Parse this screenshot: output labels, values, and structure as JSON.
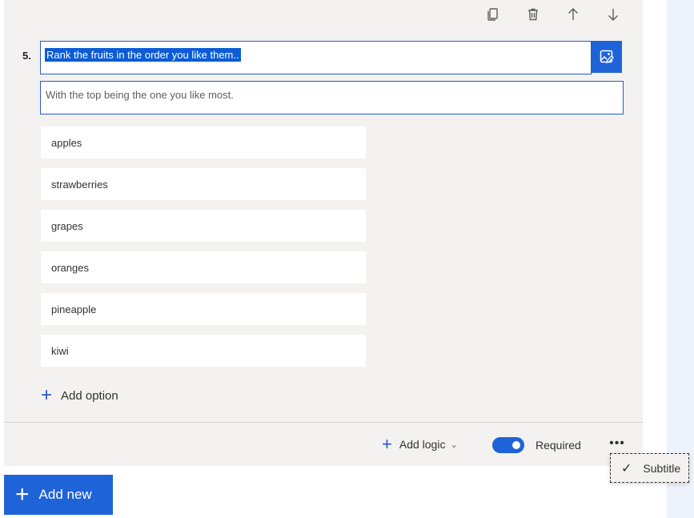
{
  "question": {
    "number": "5.",
    "title": "Rank the fruits in the order you like them..",
    "subtitle": "With the top being the one you like most.",
    "options": [
      "apples",
      "strawberries",
      "grapes",
      "oranges",
      "pineapple",
      "kiwi"
    ],
    "add_option_label": "Add option"
  },
  "toolbar": {
    "icons": [
      "copy-icon",
      "delete-icon",
      "arrow-up-icon",
      "arrow-down-icon"
    ]
  },
  "footer": {
    "add_logic_label": "Add logic",
    "required_label": "Required",
    "required_on": true,
    "more_label": "•••"
  },
  "menu": {
    "subtitle_label": "Subtitle",
    "check_glyph": "✓"
  },
  "add_new_label": "Add new",
  "colors": {
    "accent": "#1f63d8",
    "card_bg": "#f3f2f1"
  }
}
